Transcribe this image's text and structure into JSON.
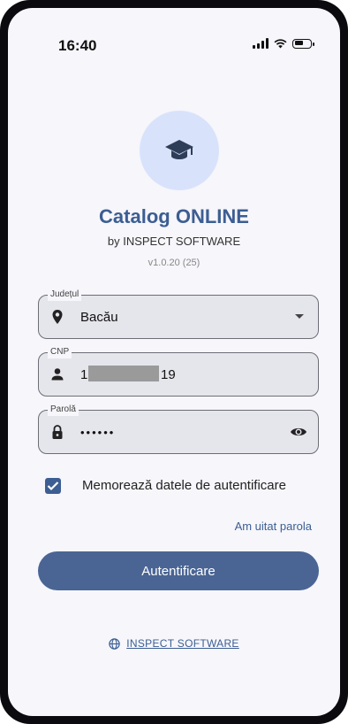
{
  "status_bar": {
    "time": "16:40"
  },
  "app": {
    "title": "Catalog ONLINE",
    "subtitle": "by INSPECT SOFTWARE",
    "version": "v1.0.20 (25)"
  },
  "form": {
    "county": {
      "label": "Județul",
      "value": "Bacău"
    },
    "cnp": {
      "label": "CNP",
      "value_start": "16",
      "value_end": "19"
    },
    "password": {
      "label": "Parolă",
      "value": "••••••"
    },
    "remember_label": "Memorează datele de autentificare",
    "remember_checked": true,
    "forgot_label": "Am uitat parola",
    "login_label": "Autentificare"
  },
  "footer": {
    "link_label": "INSPECT SOFTWARE"
  },
  "colors": {
    "accent": "#3c5e92",
    "button": "#4a6594",
    "logo_bg": "#d8e3fb"
  },
  "icons": [
    "graduation-cap-icon",
    "location-pin-icon",
    "chevron-down-icon",
    "person-icon",
    "lock-icon",
    "eye-icon",
    "checkmark-icon",
    "globe-icon"
  ]
}
